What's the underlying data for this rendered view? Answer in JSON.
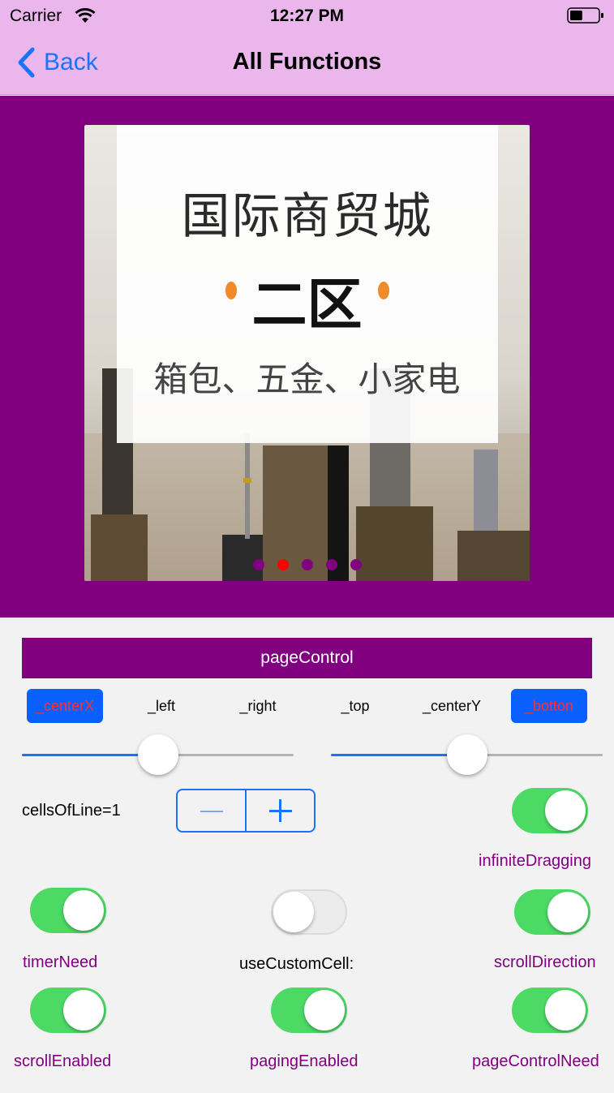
{
  "status_bar": {
    "carrier": "Carrier",
    "time": "12:27 PM",
    "battery_level": 0.45
  },
  "nav": {
    "back_label": "Back",
    "title": "All Functions"
  },
  "banner": {
    "line1": "国际商贸城",
    "line2": "二区",
    "line3": "箱包、五金、小家电",
    "page_count": 5,
    "current_page": 2
  },
  "page_control_label": "pageControl",
  "alignment": {
    "options": [
      "_centerX",
      "_left",
      "_right",
      "_top",
      "_centerY",
      "_botton"
    ],
    "selected": [
      "_centerX",
      "_botton"
    ]
  },
  "sliders": {
    "left_value": 0.5,
    "right_value": 0.5
  },
  "cells_of_line": {
    "label": "cellsOfLine=1",
    "value": 1
  },
  "switches": {
    "infinite_dragging": {
      "label": "infiniteDragging",
      "on": true
    },
    "timer_need": {
      "label": "timerNeed",
      "on": true
    },
    "use_custom_cell": {
      "label": "useCustomCell:",
      "on": false
    },
    "scroll_direction": {
      "label": "scrollDirection",
      "on": true
    },
    "scroll_enabled": {
      "label": "scrollEnabled",
      "on": true
    },
    "paging_enabled": {
      "label": "pagingEnabled",
      "on": true
    },
    "page_control_need": {
      "label": "pageControlNeed",
      "on": true
    }
  },
  "colors": {
    "nav_background": "#ebb6eb",
    "accent_purple": "#800080",
    "tint_blue": "#1a73ff",
    "page_dot_active": "#ff0000",
    "switch_on": "#4cd964"
  }
}
